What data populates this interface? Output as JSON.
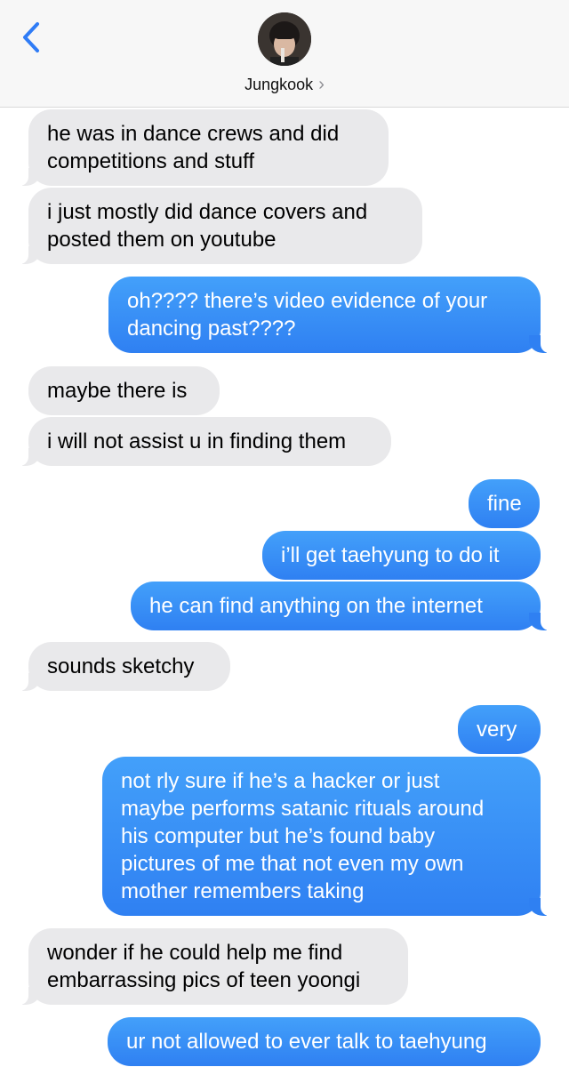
{
  "header": {
    "contact_name": "Jungkook",
    "chevron": "›",
    "back_icon": "chevron-left-icon",
    "avatar": "contact-avatar"
  },
  "colors": {
    "incoming_bubble": "#e9e9eb",
    "outgoing_bubble": "#3a8af7",
    "accent": "#2f7cf6"
  },
  "messages": [
    {
      "direction": "in",
      "text": "he was in dance crews and did\ncompetitions and stuff"
    },
    {
      "direction": "in",
      "text": "i just mostly did dance covers and\nposted them on youtube"
    },
    {
      "direction": "out",
      "text": "oh???? there’s video evidence of your\ndancing past????"
    },
    {
      "direction": "in",
      "text": "maybe there is"
    },
    {
      "direction": "in",
      "text": "i will not assist u in finding them"
    },
    {
      "direction": "out",
      "text": "fine"
    },
    {
      "direction": "out",
      "text": "i’ll get taehyung to do it"
    },
    {
      "direction": "out",
      "text": "he can find anything on the internet"
    },
    {
      "direction": "in",
      "text": "sounds sketchy"
    },
    {
      "direction": "out",
      "text": "very"
    },
    {
      "direction": "out",
      "text": "not rly sure if he’s a hacker or just\nmaybe performs satanic rituals around\nhis computer but he’s found baby\npictures of me that not even my own\nmother remembers taking"
    },
    {
      "direction": "in",
      "text": "wonder if he could help me find\nembarrassing pics of teen yoongi"
    },
    {
      "direction": "out",
      "text": "ur not allowed to ever talk to taehyung"
    }
  ]
}
